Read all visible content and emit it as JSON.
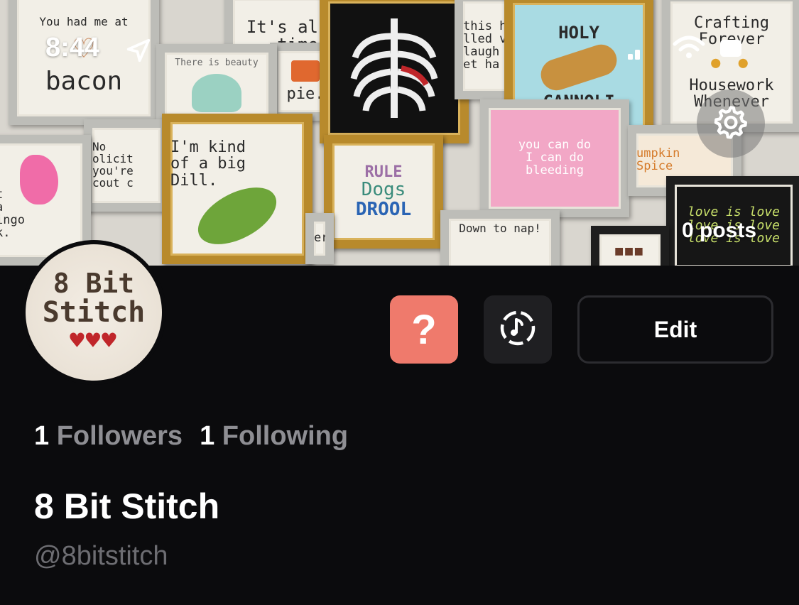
{
  "status_bar": {
    "time": "8:44"
  },
  "banner_frames": {
    "bacon_top": "You had me at",
    "bacon_bottom": "bacon",
    "always_time": "It's al\ntime",
    "pie": "pie.",
    "beauty": "There is beauty",
    "no_solicit": "No\nolicit\nyou're\ncout c",
    "dill": "I'm kind\nof a big\nDill.",
    "flamingo": "t\na\ningo\nk.",
    "dogs_rule": "RULE",
    "dogs_mid": "Dogs",
    "dogs_drool": "DROOL",
    "holy": "HOLY",
    "cannoli": "CANNOLI",
    "crafting": "Crafting\nForever",
    "housework": "Housework\nWhenever",
    "this_h": "this h\nlled v\nlaugh\net ha",
    "you_can_do": "you can do\nI can do\nbleeding",
    "pumpkin": "umpkin\nSpice",
    "love": "love is love\nlove is love\nlove is love",
    "nap": "Down to nap!",
    "er": "er"
  },
  "profile": {
    "posts_count": "0 posts",
    "avatar_line1": "8 Bit",
    "avatar_line2": "Stitch",
    "avatar_hearts": "♥♥♥",
    "help_label": "?",
    "edit_label": "Edit",
    "followers_count": "1",
    "followers_label": "Followers",
    "following_count": "1",
    "following_label": "Following",
    "display_name": "8 Bit Stitch",
    "handle": "@8bitstitch"
  },
  "icons": {
    "location": "location-arrow-icon",
    "signal": "signal-icon",
    "wifi": "wifi-icon",
    "battery": "battery-icon",
    "settings": "gear-icon",
    "music": "music-note-icon"
  },
  "colors": {
    "background": "#0b0b0d",
    "help_button": "#ef7a6c",
    "music_button": "#1f1f22",
    "muted_text": "#8e8e93"
  }
}
